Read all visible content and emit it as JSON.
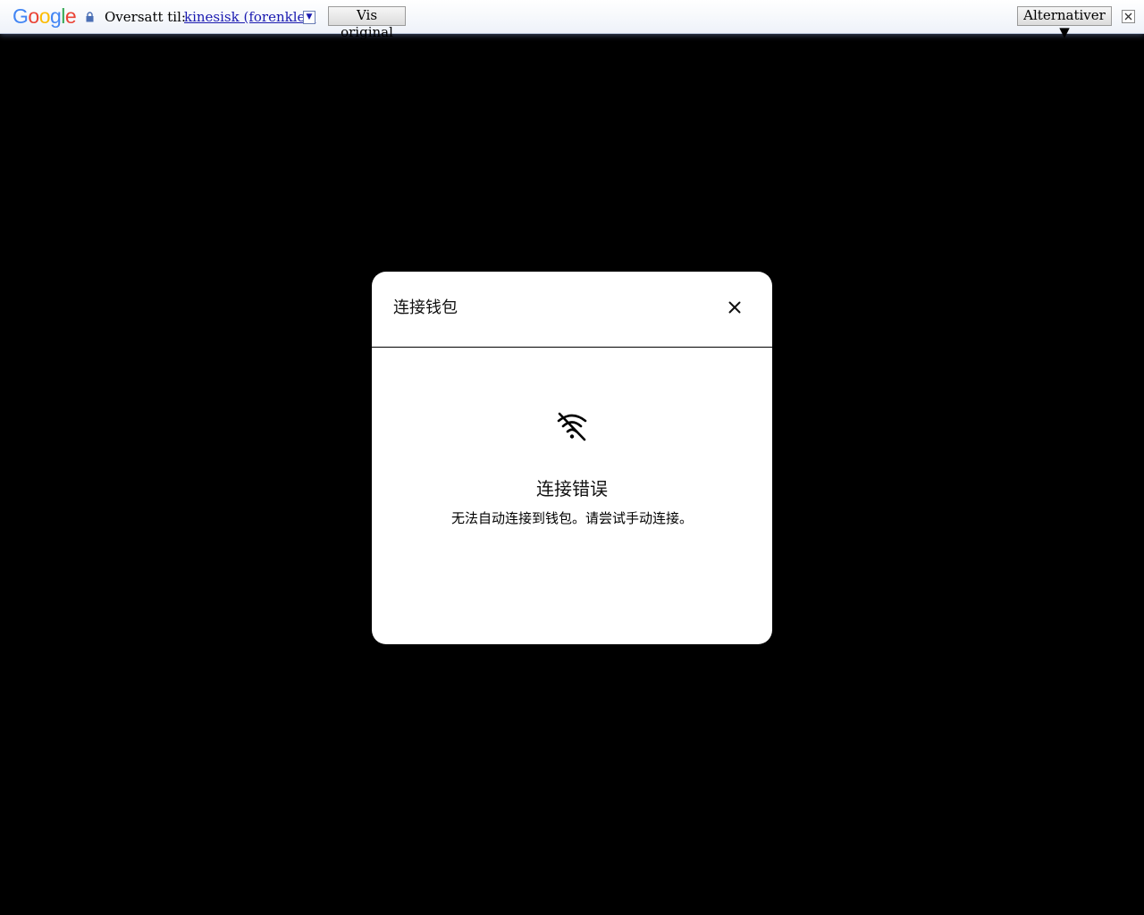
{
  "translate_bar": {
    "logo": [
      "G",
      "o",
      "o",
      "g",
      "l",
      "e"
    ],
    "translated_to_label": "Oversatt til:",
    "language": "kinesisk (forenklet)",
    "show_original": "Vis original",
    "options": "Alternativer ▼"
  },
  "modal": {
    "title": "连接钱包",
    "error_title": "连接错误",
    "error_message": "无法自动连接到钱包。请尝试手动连接。"
  }
}
